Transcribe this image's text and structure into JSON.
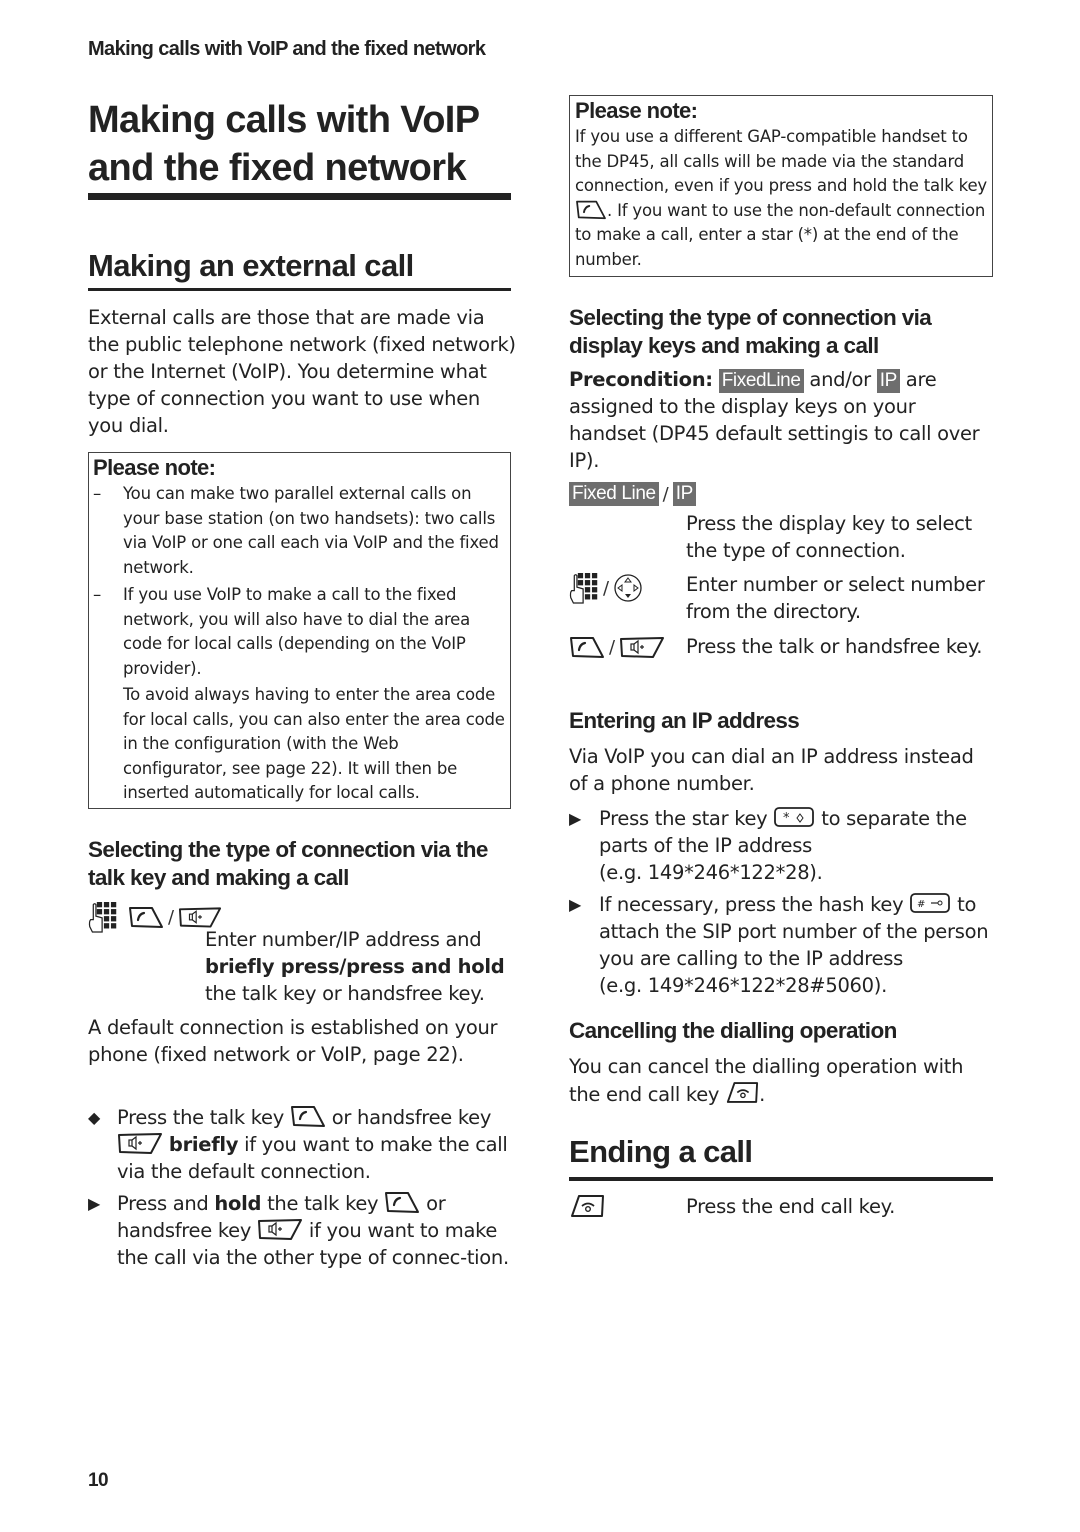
{
  "running_head": "Making calls with VoIP and the fixed network",
  "page_title": "Making calls with VoIP and the fixed network",
  "page_number": "10",
  "colors": {
    "text": "#222222",
    "softkey_bg": "#6e6e6e",
    "softkey_text": "#ffffff",
    "rule": "#222222"
  },
  "icons": {
    "keypad": "keypad-icon",
    "talk_key": "talk-key-icon",
    "handsfree_key": "handsfree-key-icon",
    "control_key": "control-key-icon",
    "star_key": "star-key-icon",
    "hash_key": "hash-key-icon",
    "end_call_key": "end-call-key-icon",
    "diamond_bullet": "◆",
    "arrow_bullet": "▶",
    "dash": "–"
  },
  "left": {
    "section_external": {
      "heading": "Making an external call",
      "intro": "External calls are those that are made via the public telephone network (fixed network) or the Internet (VoIP). You determine what type of connection you want to use when you dial."
    },
    "note": {
      "title": "Please note:",
      "items": [
        {
          "text": "You can make two parallel external calls on your base station (on two handsets): two calls via VoIP or one call each via VoIP and the fixed network."
        },
        {
          "text": "If you use VoIP to make a call to the fixed network, you will also have to dial the area code for local calls (depending on the VoIP provider).",
          "continuation": "To avoid always having to enter the area code for local calls, you can also enter the area code in the configuration (with the Web configurator, see page 22). It will then be inserted automatically for local calls."
        }
      ]
    },
    "section_talkkey": {
      "heading": "Selecting the type of connection via the talk key and making a call",
      "separator": "/",
      "desc_part1": "Enter number/IP address and",
      "desc_bold": "briefly press/press and hold",
      "desc_part2": "the talk key or handsfree key.",
      "default_conn": "A default connection is established on your phone (fixed network or VoIP, page 22).",
      "bullets": [
        {
          "pre": "Press the talk key",
          "mid": "or handsfree key",
          "bold": "briefly",
          "post": "if you want to make the call via the default connection."
        },
        {
          "pre": "Press and",
          "bold": "hold",
          "mid": "the talk key",
          "mid2": "or handsfree key",
          "post": "if you want to make the call via the other type of connec-tion."
        }
      ]
    }
  },
  "right": {
    "note": {
      "title": "Please note:",
      "text_pre": "If you use a different GAP-compatible handset to the DP45, all calls will be made via the standard connection, even if you press and hold the talk key",
      "text_post": ". If you want to use the non-default connection to make a call, enter a star (*) at the end of the number."
    },
    "section_displaykeys": {
      "heading": "Selecting the type of connection via display keys and making a call",
      "precondition_label": "Precondition:",
      "softkey_fixedline": "FixedLine",
      "and_or": "and/or",
      "softkey_ip": "IP",
      "precondition_rest": "are assigned to the display keys on your handset (DP45 default settingis to call over IP).",
      "steps": [
        {
          "softkey_a": "Fixed Line",
          "separator": "/",
          "softkey_b": "IP",
          "text": "Press the display key to select the type of connection."
        },
        {
          "separator": "/",
          "text": "Enter number or select number from the directory."
        },
        {
          "separator": "/",
          "text": "Press the talk or handsfree key."
        }
      ]
    },
    "section_ip": {
      "heading": "Entering an IP address",
      "intro": "Via VoIP you can dial an IP address instead of a phone number.",
      "bullets": [
        {
          "pre": "Press the star key",
          "post": "to separate the parts of the IP address",
          "example": "(e.g. 149*246*122*28)."
        },
        {
          "pre": "If necessary, press the hash key",
          "post": "to attach the SIP port number of the person you are calling to the IP address",
          "example": "(e.g. 149*246*122*28#5060)."
        }
      ]
    },
    "section_cancel": {
      "heading": "Cancelling the dialling operation",
      "text": "You can cancel the dialling operation with the end call key",
      "text_end": "."
    },
    "section_ending": {
      "heading": "Ending a call",
      "step_text": "Press the end call key."
    }
  }
}
